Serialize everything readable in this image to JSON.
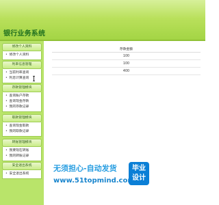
{
  "app": {
    "title": "银行业务系统"
  },
  "sidebar": {
    "sections": [
      {
        "label": "修改个人资料",
        "items": [
          "修改个人资料"
        ]
      },
      {
        "label": "利率信息管理",
        "items": [
          "当前利率查询",
          "利息计算查询"
        ]
      },
      {
        "label": "存款管理模块",
        "items": [
          "查询账户存款",
          "查询现金存款",
          "我的存款记录"
        ]
      },
      {
        "label": "取款管理模块",
        "items": [
          "查询现金取款",
          "我的取款记录"
        ]
      },
      {
        "label": "转账管理模块",
        "items": [
          "我要现在转账",
          "我的转账记录"
        ]
      },
      {
        "label": "安全退出系统",
        "items": [
          "安全退出系统"
        ]
      }
    ]
  },
  "main": {
    "table": {
      "header": "存款金额",
      "rows": [
        "100",
        "100",
        "400"
      ]
    }
  },
  "watermark": {
    "line1": "无须担心-自动发货",
    "line2": "www.51topmind.com",
    "badge_line1": "毕业",
    "badge_line2": "设计"
  }
}
